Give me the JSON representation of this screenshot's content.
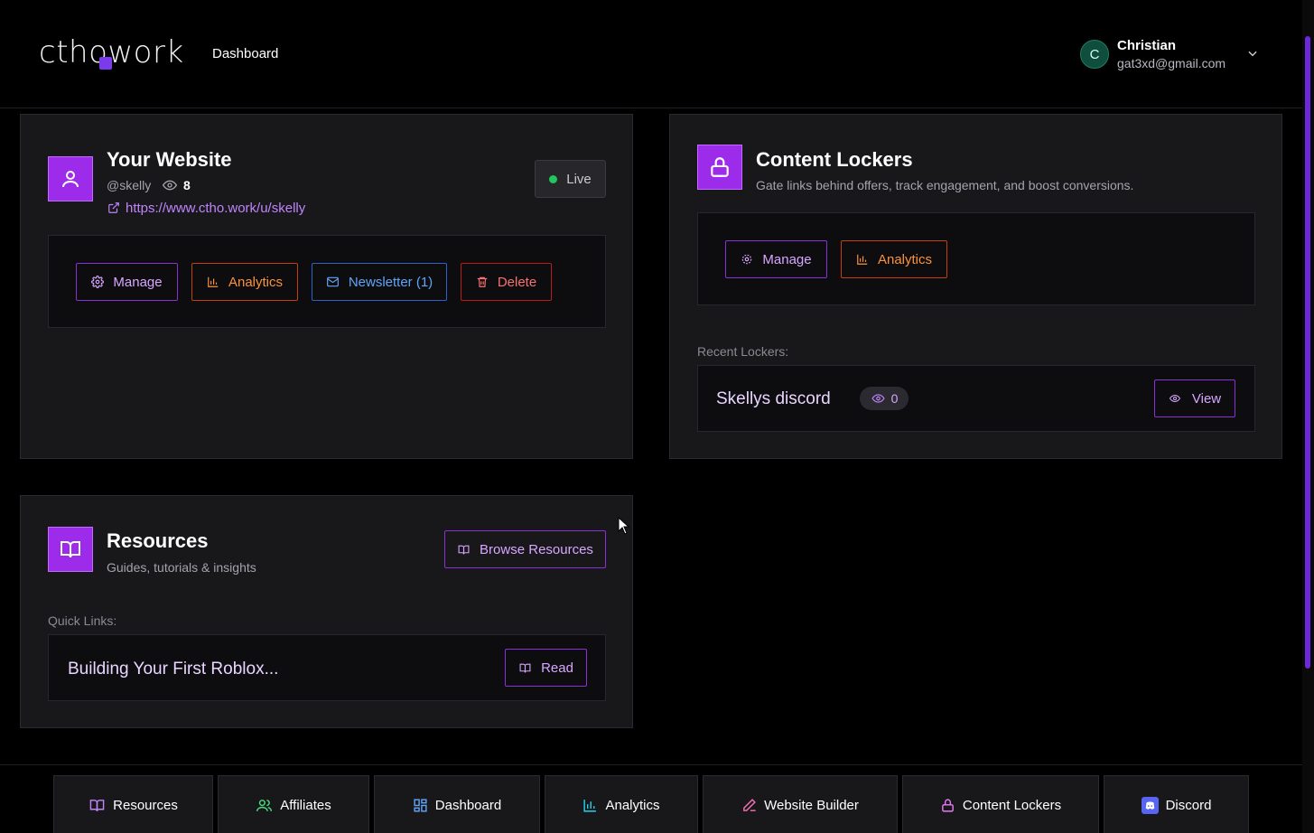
{
  "header": {
    "logo": "cthowork",
    "nav_dashboard": "Dashboard",
    "user": {
      "initial": "C",
      "name": "Christian",
      "email": "gat3xd@gmail.com"
    }
  },
  "website_card": {
    "title": "Your Website",
    "handle": "@skelly",
    "views": "8",
    "url": "https://www.ctho.work/u/skelly",
    "status": "Live",
    "buttons": {
      "manage": "Manage",
      "analytics": "Analytics",
      "newsletter": "Newsletter (1)",
      "delete": "Delete"
    }
  },
  "lockers_card": {
    "title": "Content Lockers",
    "subtitle": "Gate links behind offers, track engagement, and boost conversions.",
    "buttons": {
      "manage": "Manage",
      "analytics": "Analytics"
    },
    "recent_label": "Recent Lockers:",
    "recent": [
      {
        "name": "Skellys discord",
        "views": "0",
        "action": "View"
      }
    ]
  },
  "resources_card": {
    "title": "Resources",
    "subtitle": "Guides, tutorials & insights",
    "browse_label": "Browse Resources",
    "quick_links_label": "Quick Links:",
    "quick_links": [
      {
        "title": "Building Your First Roblox...",
        "action": "Read"
      }
    ]
  },
  "bottom_nav": [
    {
      "label": "Resources",
      "icon": "book-icon",
      "color": "#c084fc"
    },
    {
      "label": "Affiliates",
      "icon": "users-icon",
      "color": "#4ade80"
    },
    {
      "label": "Dashboard",
      "icon": "grid-icon",
      "color": "#60a5fa"
    },
    {
      "label": "Analytics",
      "icon": "bar-chart-icon",
      "color": "#22d3ee"
    },
    {
      "label": "Website Builder",
      "icon": "pencil-icon",
      "color": "#f472b6"
    },
    {
      "label": "Content Lockers",
      "icon": "lock-icon",
      "color": "#e879f9"
    },
    {
      "label": "Discord",
      "icon": "discord-icon",
      "color": "#5865f2"
    }
  ],
  "colors": {
    "accent": "#9c2bea",
    "live": "#22c55e",
    "background": "#000000",
    "card": "#18181b"
  }
}
